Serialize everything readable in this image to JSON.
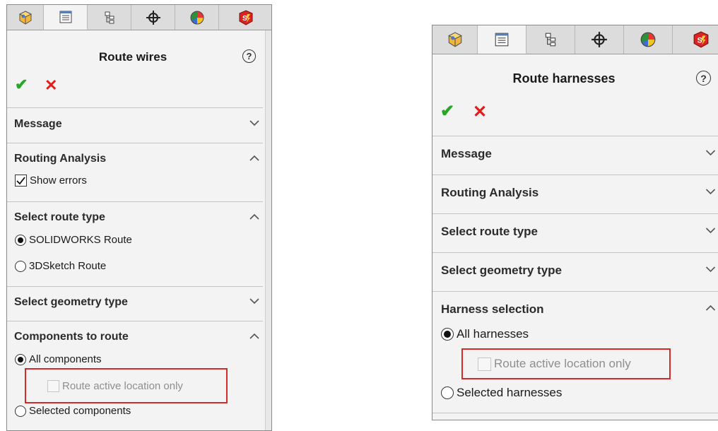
{
  "tabs": [
    {
      "name": "feature-manager-icon"
    },
    {
      "name": "property-manager-icon"
    },
    {
      "name": "configuration-manager-icon"
    },
    {
      "name": "dimxpert-icon"
    },
    {
      "name": "display-manager-icon"
    },
    {
      "name": "solidworks-addin-icon"
    }
  ],
  "left": {
    "title": "Route wires",
    "help": "?",
    "ok": "✔",
    "cancel": "✕",
    "sections": {
      "message": "Message",
      "routing_analysis": "Routing Analysis",
      "show_errors": "Show errors",
      "route_type": "Select route type",
      "route_type_opt1": "SOLIDWORKS Route",
      "route_type_opt2": "3DSketch Route",
      "geometry_type": "Select geometry type",
      "components": "Components to route",
      "all_components": "All components",
      "route_active": "Route active location only",
      "selected_components": "Selected components"
    }
  },
  "right": {
    "title": "Route harnesses",
    "help": "?",
    "ok": "✔",
    "cancel": "✕",
    "sections": {
      "message": "Message",
      "routing_analysis": "Routing Analysis",
      "route_type": "Select route type",
      "geometry_type": "Select geometry type",
      "harness_selection": "Harness selection",
      "all_harnesses": "All harnesses",
      "route_active": "Route active location only",
      "selected_harnesses": "Selected harnesses"
    }
  },
  "colors": {
    "accent_ok": "#2aa52a",
    "accent_cancel": "#e31b1b",
    "highlight": "#d32a2a"
  }
}
